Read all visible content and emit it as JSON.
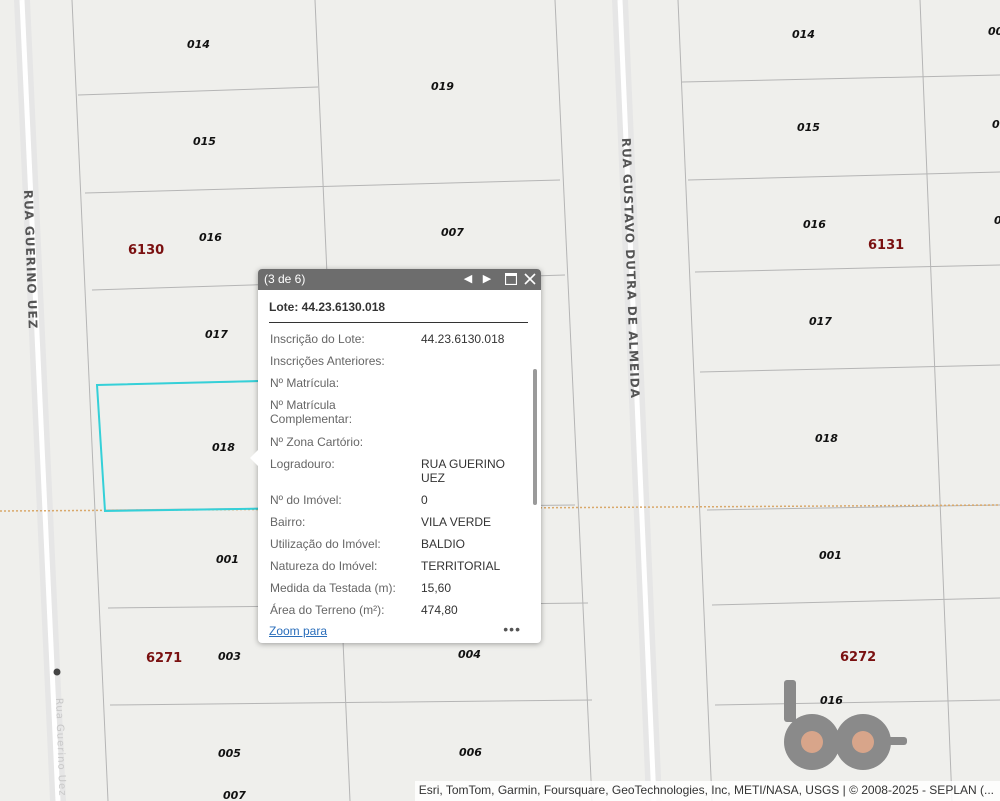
{
  "map": {
    "streets": [
      "RUA GUERINO UEZ",
      "RUA GUSTAVO DUTRA DE ALMEIDA",
      "Rua Guerino Uez"
    ],
    "blocks": [
      "6130",
      "6131",
      "6271",
      "6272"
    ],
    "lots": [
      "014",
      "019",
      "015",
      "016",
      "007",
      "017",
      "018",
      "001",
      "003",
      "004",
      "005",
      "006",
      "007",
      "014",
      "015",
      "016",
      "017",
      "018",
      "001",
      "016",
      "00",
      "0",
      "0"
    ]
  },
  "popup": {
    "counter": "(3 de 6)",
    "title": "Lote: 44.23.6130.018",
    "fields": [
      {
        "label": "Inscrição do Lote:",
        "value": "44.23.6130.018"
      },
      {
        "label": "Inscrições Anteriores:",
        "value": ""
      },
      {
        "label": "Nº Matrícula:",
        "value": ""
      },
      {
        "label": "Nº Matrícula Complementar:",
        "value": ""
      },
      {
        "label": "Nº Zona Cartório:",
        "value": ""
      },
      {
        "label": "Logradouro:",
        "value": "RUA GUERINO UEZ"
      },
      {
        "label": "Nº do Imóvel:",
        "value": "0"
      },
      {
        "label": "Bairro:",
        "value": "VILA VERDE"
      },
      {
        "label": "Utilização do Imóvel:",
        "value": "BALDIO"
      },
      {
        "label": "Natureza do Imóvel:",
        "value": "TERRITORIAL"
      },
      {
        "label": "Medida da Testada (m):",
        "value": "15,60"
      },
      {
        "label": "Área do Terreno (m²):",
        "value": "474,80"
      }
    ],
    "zoom_label": "Zoom para",
    "more_label": "•••",
    "icons": {
      "prev": "triangle-left-icon",
      "next": "triangle-right-icon",
      "dock": "dock-icon",
      "close": "close-icon"
    }
  },
  "attribution": "Esri, TomTom, Garmin, Foursquare, GeoTechnologies, Inc, METI/NASA, USGS | © 2008-2025 - SEPLAN (...",
  "colors": {
    "selection": "#35d0d8",
    "block_label": "#7a1010",
    "boundary": "#d9a86a",
    "header": "#6d6d6d",
    "link": "#2a6ebb"
  }
}
